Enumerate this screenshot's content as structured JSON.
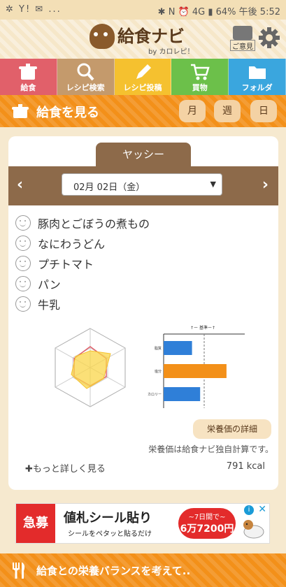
{
  "status": {
    "left": "✲ Y! ✉ ...",
    "right": "✱ N ⏰ 4G ▮ 64% 午後 5:52"
  },
  "header": {
    "title": "給食ナビ",
    "by": "by カロレピ！",
    "feedback": "ご意見"
  },
  "nav": [
    {
      "label": "給食",
      "color": "#e1606a",
      "icon": "pot-icon"
    },
    {
      "label": "レシピ検索",
      "color": "#c49a6c",
      "icon": "search-icon"
    },
    {
      "label": "レシピ投稿",
      "color": "#f5c12f",
      "icon": "pencil-icon"
    },
    {
      "label": "買物",
      "color": "#6cc04a",
      "icon": "cart-icon"
    },
    {
      "label": "フォルダ",
      "color": "#3aa6de",
      "icon": "folder-icon"
    }
  ],
  "section": {
    "title": "給食を見る",
    "month": "月",
    "week": "週",
    "day": "日"
  },
  "card": {
    "tab": "ヤッシー",
    "date": "02月 02日（金）",
    "menu": [
      "豚肉とごぼうの煮もの",
      "なにわうどん",
      "プチトマト",
      "パン",
      "牛乳"
    ],
    "detail_button": "栄養価の詳細",
    "note": "栄養価は給食ナビ独自計算です。",
    "more": "✚もっと詳しく見る",
    "kcal": "791 kcal"
  },
  "chart_data": {
    "type": "bar",
    "title": "↑ー 基準ー↑",
    "categories": [
      "脂質",
      "塩分",
      "カロリー"
    ],
    "values": [
      0.7,
      1.55,
      0.9
    ],
    "bar_colors": [
      "#2f7fd8",
      "#f39019",
      "#2f7fd8"
    ],
    "reference_line": 1.0,
    "xlim": [
      0,
      2
    ]
  },
  "ad": {
    "badge": "急募",
    "headline": "値札シール貼り",
    "sub": "シールをペタッと貼るだけ",
    "price_top": "~7日間で~",
    "price": "6万7200円"
  },
  "footer": {
    "text": "給食との栄養バランスを考えて.."
  }
}
